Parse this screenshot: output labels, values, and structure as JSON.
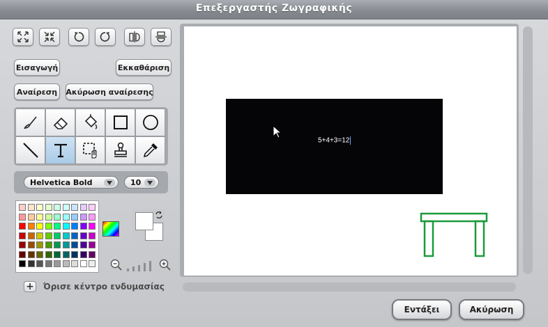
{
  "window": {
    "title": "Επεξεργαστής Ζωγραφικής"
  },
  "toolbar_icons": [
    "grow-icon",
    "shrink-icon",
    "rotate-left-icon",
    "rotate-right-icon",
    "flip-horizontal-icon",
    "flip-vertical-icon"
  ],
  "buttons": {
    "import": "Εισαγωγή",
    "clear": "Εκκαθάριση",
    "undo": "Αναίρεση",
    "redo": "Ακύρωση αναίρεσης"
  },
  "tools": [
    "paintbrush-icon",
    "eraser-icon",
    "fill-bucket-icon",
    "rectangle-icon",
    "ellipse-icon",
    "line-icon",
    "text-icon",
    "select-icon",
    "stamp-icon",
    "eyedropper-icon"
  ],
  "selected_tool": "text-icon",
  "font": {
    "family": "Helvetica Bold",
    "size": "10"
  },
  "palette": {
    "colors": [
      [
        "#ffcccc",
        "#ffe5cc",
        "#ffffcc",
        "#e5ffcc",
        "#ccffe5",
        "#ccffff",
        "#cce5ff",
        "#e5ccff",
        "#ffccff"
      ],
      [
        "#ff9999",
        "#ffcc99",
        "#ffff99",
        "#ccff99",
        "#99ffcc",
        "#99ffff",
        "#99ccff",
        "#cc99ff",
        "#ff99ff"
      ],
      [
        "#ff0000",
        "#ff8000",
        "#ffff00",
        "#80ff00",
        "#00ff80",
        "#00ffff",
        "#0080ff",
        "#8000ff",
        "#ff00ff"
      ],
      [
        "#cc0000",
        "#cc6600",
        "#cccc00",
        "#66cc00",
        "#00cc66",
        "#00cccc",
        "#0066cc",
        "#6600cc",
        "#cc00cc"
      ],
      [
        "#990000",
        "#994c00",
        "#999900",
        "#4c9900",
        "#00994c",
        "#009999",
        "#004c99",
        "#4c0099",
        "#990099"
      ],
      [
        "#660000",
        "#663300",
        "#666600",
        "#336600",
        "#006633",
        "#006666",
        "#003366",
        "#330066",
        "#660066"
      ],
      [
        "#000000",
        "#333333",
        "#555555",
        "#777777",
        "#999999",
        "#bbbbbb",
        "#dddddd",
        "#ffffff",
        "#eeeeee"
      ]
    ],
    "foreground": "#ffffff",
    "background": "#ffffff"
  },
  "canvas": {
    "text_value": "5+4+3=12",
    "rect_color": "#050508",
    "drawing_color": "#1a9a3a"
  },
  "costume_center": {
    "label": "Όρισε κέντρο ενδυμασίας"
  },
  "footer": {
    "ok": "Εντάξει",
    "cancel": "Ακύρωση"
  }
}
